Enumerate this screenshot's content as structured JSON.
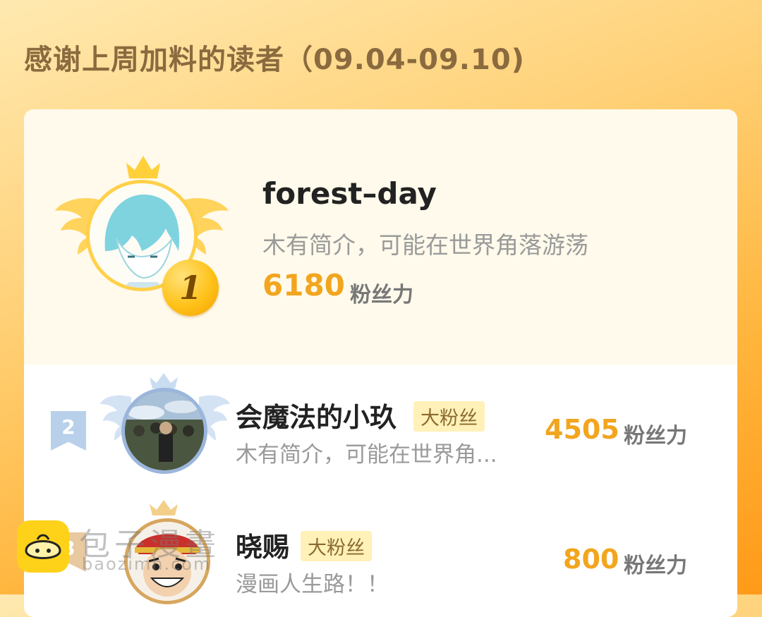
{
  "header": {
    "title": "感谢上周加料的读者（09.04-09.10)"
  },
  "first_place": {
    "rank": "1",
    "name": "forest–day",
    "bio": "木有简介，可能在世界角落游荡",
    "score": "6180",
    "score_label": "粉丝力"
  },
  "rankings": [
    {
      "rank": "2",
      "name": "会魔法的小玖",
      "tag": "大粉丝",
      "bio": "木有简介，可能在世界角...",
      "score": "4505",
      "score_label": "粉丝力"
    },
    {
      "rank": "3",
      "name": "晓赐",
      "tag": "大粉丝",
      "bio": "漫画人生路！！",
      "score": "800",
      "score_label": "粉丝力"
    }
  ],
  "watermark": {
    "text": "包子漫畫",
    "url": "baozimh.com"
  },
  "colors": {
    "accent_orange": "#f2a51e",
    "gold": "#ffc21a",
    "silver_blue": "#9bb6dc"
  }
}
